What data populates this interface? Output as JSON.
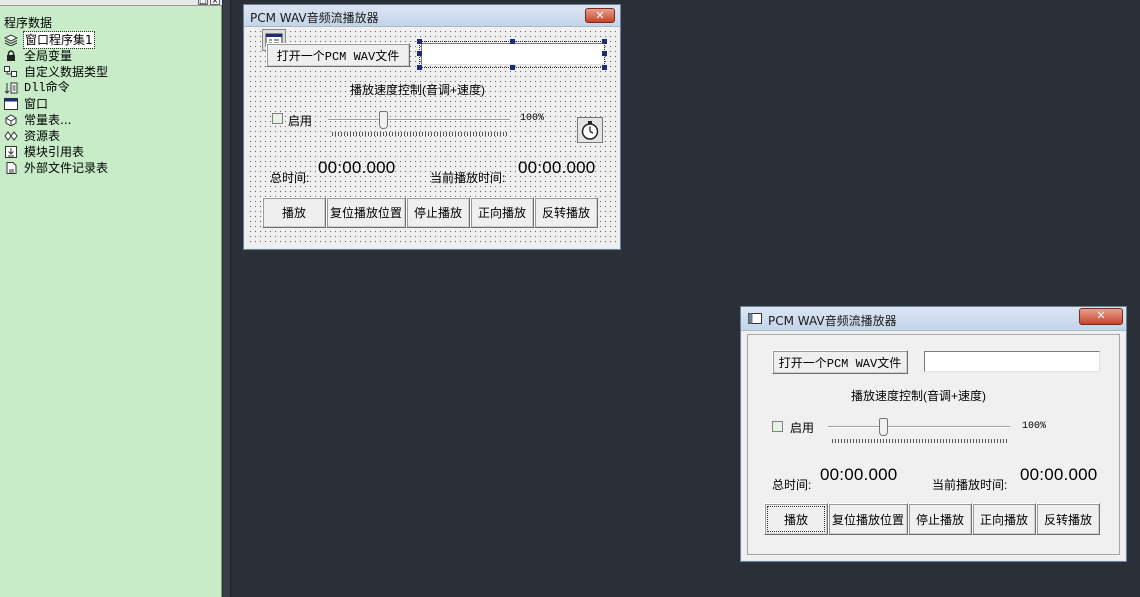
{
  "tree": {
    "root": "程序数据",
    "items": [
      {
        "label": "窗口程序集1",
        "icon": "layers-icon",
        "selected": true
      },
      {
        "label": "全局变量",
        "icon": "lock-icon"
      },
      {
        "label": "自定义数据类型",
        "icon": "data-type-icon"
      },
      {
        "label": "Dll命令",
        "icon": "dll-icon"
      },
      {
        "label": "窗口",
        "icon": "window-icon"
      },
      {
        "label": "常量表...",
        "icon": "constants-icon"
      },
      {
        "label": "资源表",
        "icon": "resource-icon"
      },
      {
        "label": "模块引用表",
        "icon": "module-icon"
      },
      {
        "label": "外部文件记录表",
        "icon": "file-icon"
      }
    ]
  },
  "designer_window": {
    "title": "PCM WAV音频流播放器",
    "close": "✕",
    "open_button": "打开一个PCM WAV文件",
    "file_path": "",
    "speed_caption": "播放速度控制(音调+速度)",
    "enable_label": "启用",
    "speed_percent": "100%",
    "speed_level": 0.3,
    "total_time_label": "总时间:",
    "total_time": "00:00.000",
    "current_time_label": "当前播放时间:",
    "current_time": "00:00.000",
    "buttons": [
      "播放",
      "复位播放位置",
      "停止播放",
      "正向播放",
      "反转播放"
    ]
  },
  "runtime_window": {
    "title": "PCM WAV音频流播放器",
    "close": "✕",
    "open_button": "打开一个PCM WAV文件",
    "file_path": "",
    "speed_caption": "播放速度控制(音调+速度)",
    "enable_label": "启用",
    "speed_percent": "100%",
    "speed_level": 0.3,
    "total_time_label": "总时间:",
    "total_time": "00:00.000",
    "current_time_label": "当前播放时间:",
    "current_time": "00:00.000",
    "buttons": [
      "播放",
      "复位播放位置",
      "停止播放",
      "正向播放",
      "反转播放"
    ]
  },
  "colors": {
    "tree_bg": "#c8ecc8",
    "workspace_bg": "#2b2f38",
    "close_button": "#c4442b",
    "selection_handle": "#1c2b78"
  }
}
